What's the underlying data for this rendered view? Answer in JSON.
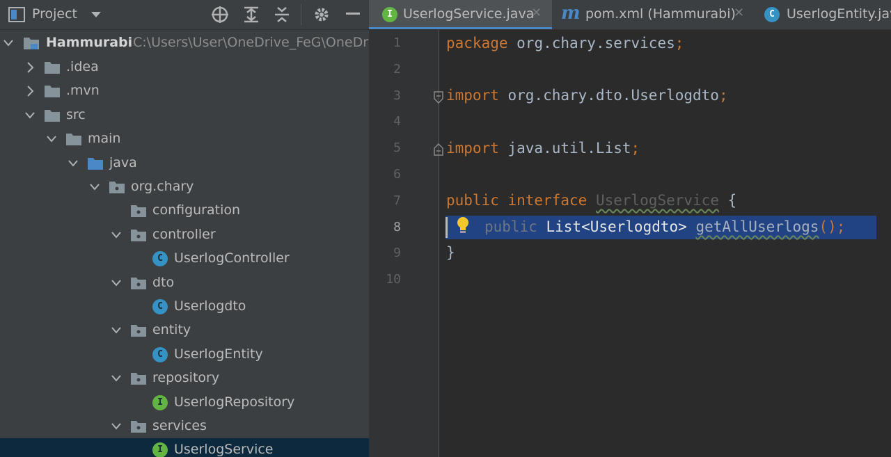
{
  "project_panel": {
    "title": "Project",
    "root": {
      "name": "Hammurabi",
      "path": "C:\\Users\\User\\OneDrive_FeG\\OneDriv"
    },
    "tree": [
      {
        "label": ".idea",
        "type": "folder",
        "expanded": false
      },
      {
        "label": ".mvn",
        "type": "folder",
        "expanded": false
      },
      {
        "label": "src",
        "type": "folder",
        "expanded": true
      },
      {
        "label": "main",
        "type": "folder",
        "expanded": true
      },
      {
        "label": "java",
        "type": "folder",
        "expanded": true
      },
      {
        "label": "org.chary",
        "type": "package",
        "expanded": true
      },
      {
        "label": "configuration",
        "type": "package",
        "expanded": false
      },
      {
        "label": "controller",
        "type": "package",
        "expanded": true
      },
      {
        "label": "UserlogController",
        "type": "class",
        "badge": "C"
      },
      {
        "label": "dto",
        "type": "package",
        "expanded": true
      },
      {
        "label": "Userlogdto",
        "type": "class",
        "badge": "C"
      },
      {
        "label": "entity",
        "type": "package",
        "expanded": true
      },
      {
        "label": "UserlogEntity",
        "type": "class",
        "badge": "C"
      },
      {
        "label": "repository",
        "type": "package",
        "expanded": true
      },
      {
        "label": "UserlogRepository",
        "type": "interface",
        "badge": "I"
      },
      {
        "label": "services",
        "type": "package",
        "expanded": true
      },
      {
        "label": "UserlogService",
        "type": "interface",
        "badge": "I",
        "selected": true
      }
    ]
  },
  "tabs": [
    {
      "label": "UserlogService.java",
      "icon": "I",
      "active": true
    },
    {
      "label": "pom.xml (Hammurabi)",
      "icon": "m"
    },
    {
      "label": "UserlogEntity.jav",
      "icon": "C"
    }
  ],
  "editor": {
    "line_numbers": [
      "1",
      "2",
      "3",
      "4",
      "5",
      "6",
      "7",
      "8",
      "9",
      "10"
    ],
    "code": {
      "l1_kw": "package",
      "l1_rest": " org.chary.services",
      "l1_semi": ";",
      "l3_kw": "import",
      "l3_rest": " org.chary.dto.Userlogdto",
      "l3_semi": ";",
      "l5_kw": "import",
      "l5_rest": " java.util.List",
      "l5_semi": ";",
      "l7_kw1": "public",
      "l7_kw2": " interface",
      "l7_name": "UserlogService",
      "l7_brace": " {",
      "l8_kw": "public",
      "l8_type": " List<Userlogdto> ",
      "l8_method": "getAllUserlogs",
      "l8_end": "();",
      "l9": "}"
    }
  },
  "colors": {
    "accent": "#4a88c7",
    "selection": "#214283",
    "keyword": "#cc7832"
  }
}
